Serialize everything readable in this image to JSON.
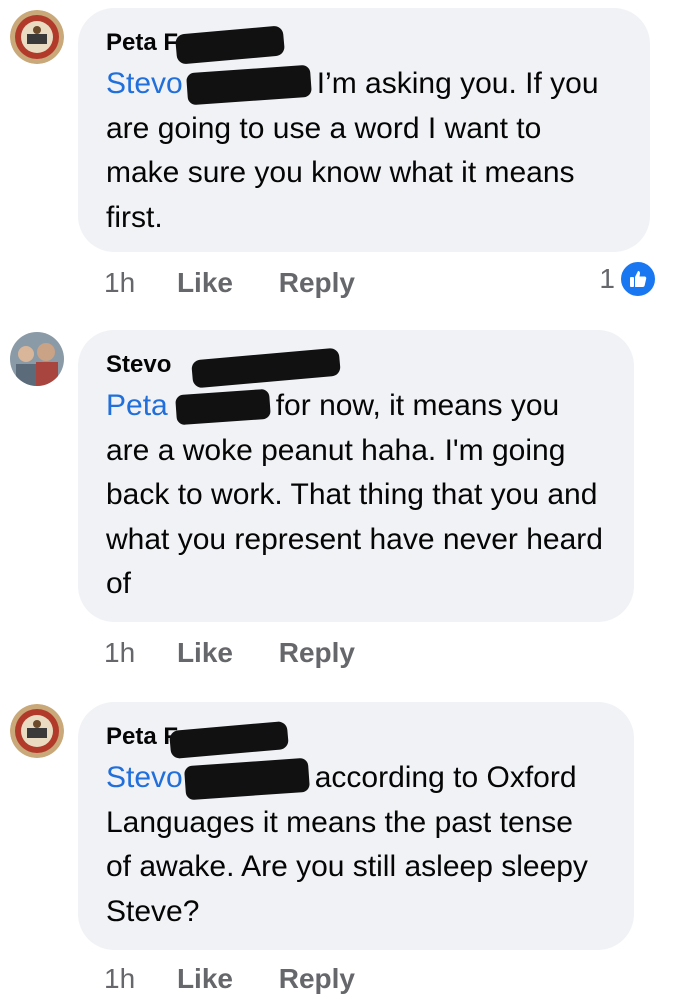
{
  "comments": [
    {
      "author": "Peta F",
      "mention": "Stevo",
      "text": "I’m asking you. If you are going to use a word I want to make sure you know what it means first.",
      "time": "1h",
      "like_label": "Like",
      "reply_label": "Reply",
      "reaction_count": "1",
      "reaction_icon": "like-reaction-icon"
    },
    {
      "author": "Stevo",
      "mention": "Peta",
      "text": "for now, it means you are a woke peanut haha. I'm going back to work. That thing that you and what you represent have never heard of",
      "time": "1h",
      "like_label": "Like",
      "reply_label": "Reply"
    },
    {
      "author": "Peta F",
      "mention": "Stevo",
      "text": "according to Oxford Languages it means the past tense of awake. Are you still asleep sleepy Steve?",
      "time": "1h",
      "like_label": "Like",
      "reply_label": "Reply"
    }
  ],
  "colors": {
    "bubble": "#f0f2f5",
    "mention": "#216fdb",
    "meta": "#65676b",
    "like_badge": "#1a77f2"
  }
}
